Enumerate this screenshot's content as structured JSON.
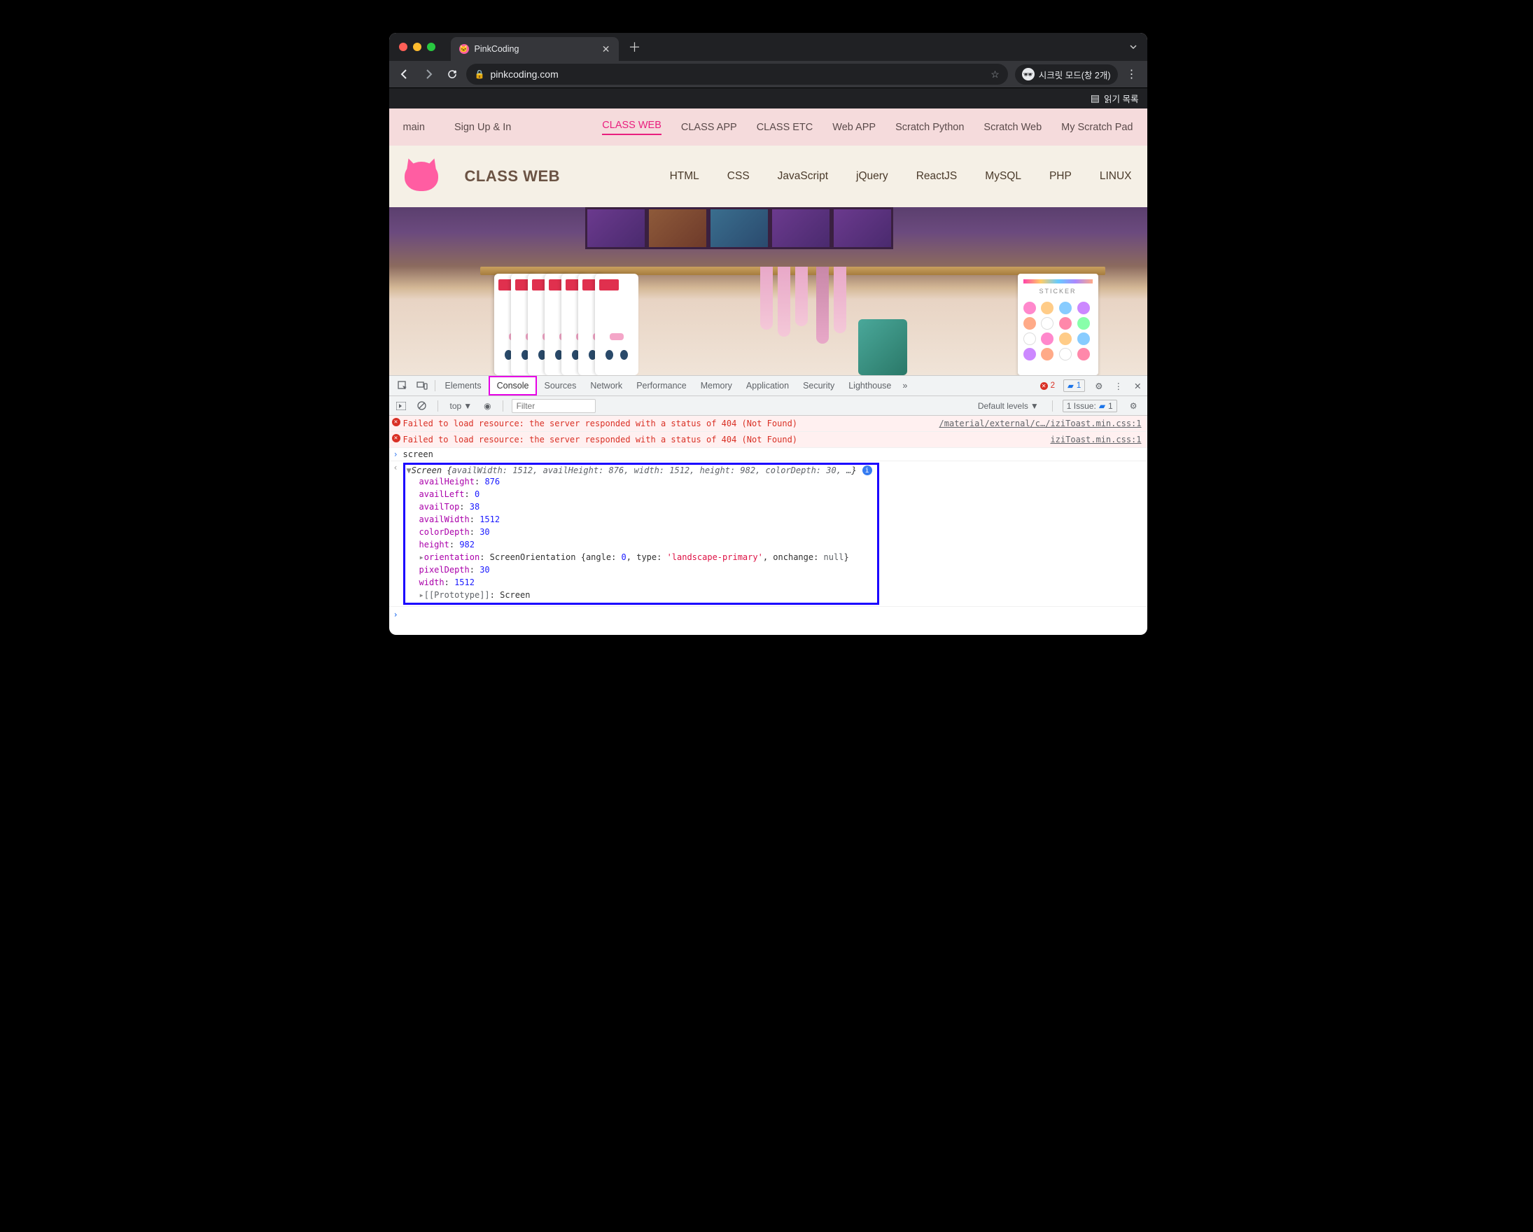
{
  "browser": {
    "tab_title": "PinkCoding",
    "url": "pinkcoding.com",
    "incognito_label": "시크릿 모드(창 2개)",
    "reading_list": "읽기 목록"
  },
  "topnav": {
    "left": [
      "main",
      "Sign Up & In"
    ],
    "right": [
      "CLASS WEB",
      "CLASS APP",
      "CLASS ETC",
      "Web APP",
      "Scratch Python",
      "Scratch Web",
      "My Scratch Pad"
    ],
    "active": "CLASS WEB"
  },
  "subnav": {
    "brand": "CLASS WEB",
    "links": [
      "HTML",
      "CSS",
      "JavaScript",
      "jQuery",
      "ReactJS",
      "MySQL",
      "PHP",
      "LINUX"
    ]
  },
  "hero": {
    "sticker_label": "STICKER"
  },
  "devtools": {
    "tabs": [
      "Elements",
      "Console",
      "Sources",
      "Network",
      "Performance",
      "Memory",
      "Application",
      "Security",
      "Lighthouse"
    ],
    "active_tab": "Console",
    "error_count": "2",
    "info_count": "1",
    "filter_top": "top",
    "filter_placeholder": "Filter",
    "levels": "Default levels",
    "issues_label": "1 Issue:",
    "issues_count": "1",
    "errors": [
      {
        "msg": "Failed to load resource: the server responded with a status of 404 (Not Found)",
        "src": "/material/external/c…/iziToast.min.css:1"
      },
      {
        "msg": "Failed to load resource: the server responded with a status of 404 (Not Found)",
        "src": "iziToast.min.css:1"
      }
    ],
    "input": "screen",
    "screen_header": {
      "type": "Screen",
      "availWidth": "1512",
      "availHeight": "876",
      "width": "1512",
      "height": "982",
      "colorDepth": "30"
    },
    "screen_props": {
      "availHeight": "876",
      "availLeft": "0",
      "availTop": "38",
      "availWidth": "1512",
      "colorDepth": "30",
      "height": "982",
      "orientation_type": "ScreenOrientation",
      "orientation_angle": "0",
      "orientation_typeval": "'landscape-primary'",
      "orientation_onchange": "null",
      "pixelDepth": "30",
      "width": "1512",
      "prototype": "Screen"
    }
  }
}
